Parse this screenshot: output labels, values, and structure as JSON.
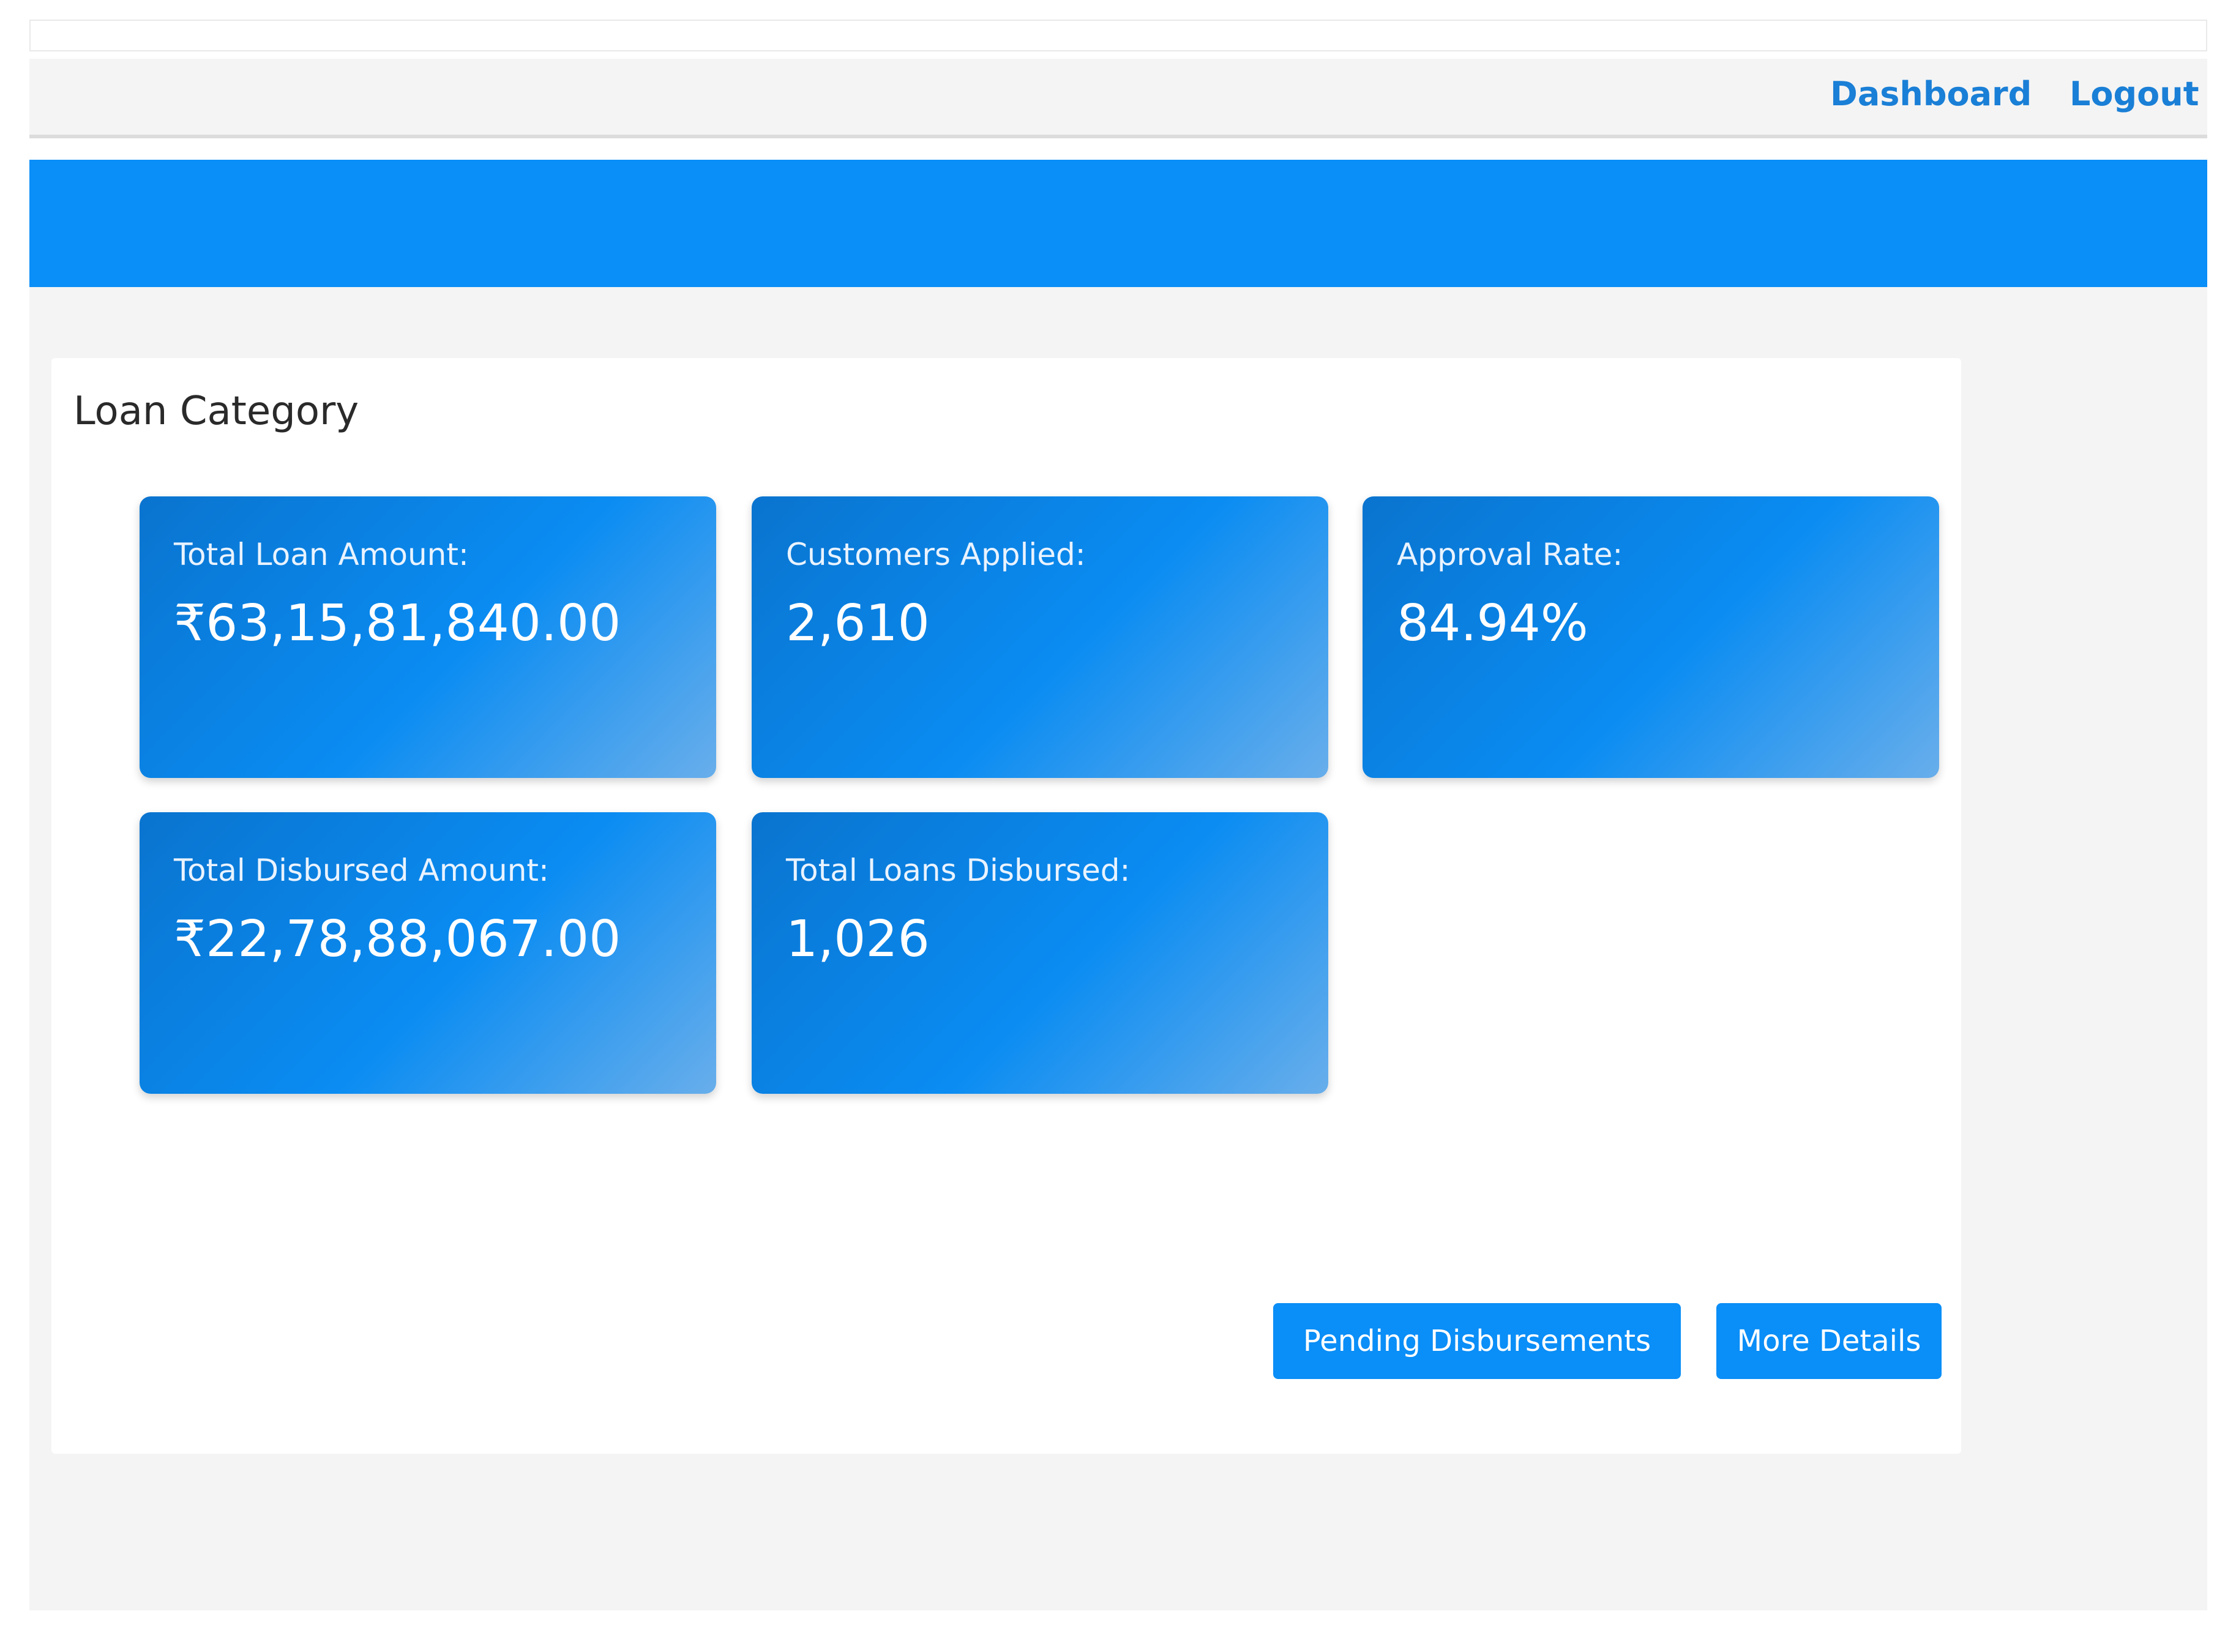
{
  "nav": {
    "dashboard": "Dashboard",
    "logout": "Logout"
  },
  "panel": {
    "title": "Loan Category"
  },
  "cards": [
    {
      "label": "Total Loan Amount:",
      "value": "₹63,15,81,840.00"
    },
    {
      "label": "Customers Applied:",
      "value": "2,610"
    },
    {
      "label": "Approval Rate:",
      "value": "84.94%"
    },
    {
      "label": "Total Disbursed Amount:",
      "value": "₹22,78,88,067.00"
    },
    {
      "label": "Total Loans Disbursed:",
      "value": "1,026"
    }
  ],
  "buttons": {
    "pending": "Pending Disbursements",
    "more": "More Details"
  },
  "colors": {
    "accent": "#0a8ef7",
    "link": "#1a7fd6"
  }
}
